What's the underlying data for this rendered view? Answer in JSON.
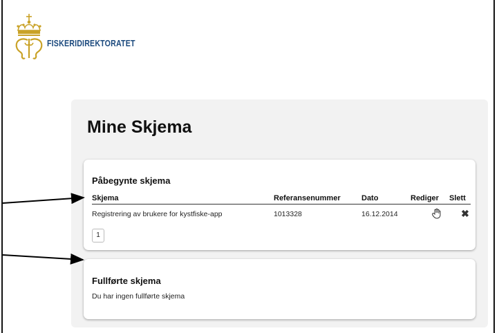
{
  "header": {
    "brand": "FISKERIDIREKTORATET",
    "logo_icon": "crown-seahorse-emblem-icon"
  },
  "page": {
    "title": "Mine Skjema"
  },
  "in_progress": {
    "title": "Påbegynte skjema",
    "columns": {
      "form": "Skjema",
      "reference": "Referansenummer",
      "date": "Dato",
      "edit": "Rediger",
      "delete": "Slett"
    },
    "rows": [
      {
        "form": "Registrering av brukere for kystfiske-app",
        "reference": "1013328",
        "date": "16.12.2014",
        "edit_icon": "hand-pointer-icon",
        "delete_icon": "close-icon"
      }
    ],
    "pagination": {
      "current_page": "1"
    }
  },
  "completed": {
    "title": "Fullførte skjema",
    "empty_message": "Du har ingen fullførte skjema"
  },
  "colors": {
    "brand_blue": "#1c4a7e",
    "logo_gold": "#c9a227",
    "panel_bg": "#f2f2f2"
  }
}
